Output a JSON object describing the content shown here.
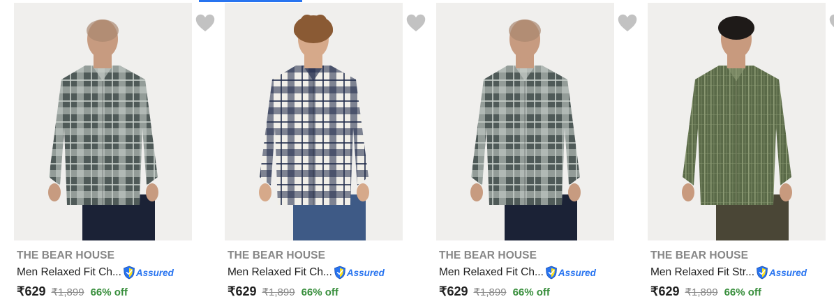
{
  "products": [
    {
      "brand": "THE BEAR HOUSE",
      "title": "Men Relaxed Fit Ch...",
      "assured": "Assured",
      "price": "₹629",
      "mrp": "₹1,899",
      "discount": "66% off",
      "image": "model-grey-checked-shirt",
      "shirt_color": "#4f5a58",
      "check_color": "#c9d1cc",
      "pants_color": "#1b2236",
      "skin": "#c79b80",
      "hair": "bald"
    },
    {
      "brand": "THE BEAR HOUSE",
      "title": "Men Relaxed Fit Ch...",
      "assured": "Assured",
      "price": "₹629",
      "mrp": "₹1,899",
      "discount": "66% off",
      "image": "model-navy-white-checked-shirt",
      "shirt_color": "#f1efe9",
      "check_color": "#1f2a4a",
      "pants_color": "#3e5a86",
      "skin": "#d6a98a",
      "hair": "curly"
    },
    {
      "brand": "THE BEAR HOUSE",
      "title": "Men Relaxed Fit Ch...",
      "assured": "Assured",
      "price": "₹629",
      "mrp": "₹1,899",
      "discount": "66% off",
      "image": "model-grey-checked-shirt",
      "shirt_color": "#4f5a58",
      "check_color": "#c9d1cc",
      "pants_color": "#1b2236",
      "skin": "#c79b80",
      "hair": "bald"
    },
    {
      "brand": "THE BEAR HOUSE",
      "title": "Men Relaxed Fit Str...",
      "assured": "Assured",
      "price": "₹629",
      "mrp": "₹1,899",
      "discount": "66% off",
      "image": "model-olive-striped-shirt",
      "shirt_color": "#5a6a48",
      "check_color": "#8c9a74",
      "pants_color": "#4a4636",
      "skin": "#c89a7e",
      "hair": "short"
    }
  ]
}
